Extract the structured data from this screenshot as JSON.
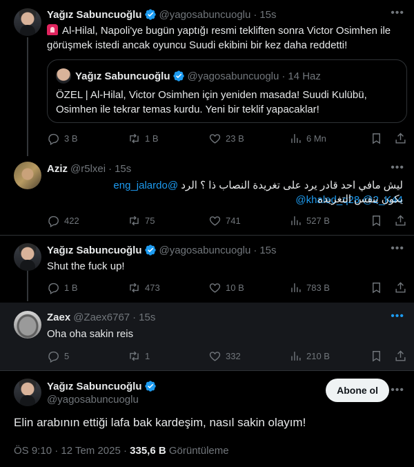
{
  "tweet1": {
    "name": "Yağız Sabuncuoğlu",
    "handle": "@yagosabuncuoglu",
    "time": "15s",
    "text": "Al-Hilal, Napoli'ye bugün yaptığı resmi tekliften sonra Victor Osimhen ile görüşmek istedi ancak oyuncu Suudi ekibini bir kez daha reddetti!",
    "quote": {
      "name": "Yağız Sabuncuoğlu",
      "handle": "@yagosabuncuoglu",
      "time": "14 Haz",
      "text": "ÖZEL | Al-Hilal, Victor Osimhen için yeniden masada! Suudi Kulübü, Osimhen ile tekrar temas kurdu. Yeni bir teklif yapacaklar!"
    },
    "stats": {
      "replies": "3 B",
      "reposts": "1 B",
      "likes": "23 B",
      "views": "6 Mn"
    }
  },
  "tweet2": {
    "name": "Aziz",
    "handle": "@r5lxei",
    "time": "15s",
    "mentions": "@eng_jalardo @khaled_q28 @2_K44",
    "text_line1": "ليش مافي احد قادر يرد على تغريدة النصاب ذا ؟ الرد",
    "text_line2": "يكون بنفس التغريده",
    "stats": {
      "replies": "422",
      "reposts": "75",
      "likes": "741",
      "views": "527 B"
    }
  },
  "tweet3": {
    "name": "Yağız Sabuncuoğlu",
    "handle": "@yagosabuncuoglu",
    "time": "15s",
    "text": "Shut the fuck up!",
    "stats": {
      "replies": "1 B",
      "reposts": "473",
      "likes": "10 B",
      "views": "783 B"
    }
  },
  "tweet4": {
    "name": "Zaex",
    "handle": "@Zaex6767",
    "time": "15s",
    "text": "Oha oha sakin reis",
    "stats": {
      "replies": "5",
      "reposts": "1",
      "likes": "332",
      "views": "210 B"
    }
  },
  "main_tweet": {
    "name": "Yağız Sabuncuoğlu",
    "handle": "@yagosabuncuoglu",
    "follow_label": "Abone ol",
    "text": "Elin arabının ettiği lafa bak kardeşim, nasıl sakin olayım!",
    "timestamp": "ÖS 9:10 · 12 Tem 2025 · ",
    "views_count": "335,6 B",
    "views_label": " Görüntüleme"
  },
  "colors": {
    "accent": "#1d9bf0",
    "background": "#000000",
    "muted": "#71767b",
    "border": "#2f3336"
  },
  "icons": [
    "verified-badge-icon",
    "siren-icon",
    "reply-icon",
    "repost-icon",
    "like-icon",
    "views-icon",
    "bookmark-icon",
    "share-icon",
    "more-icon"
  ]
}
